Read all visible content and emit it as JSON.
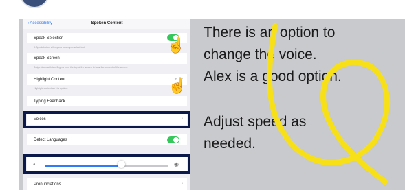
{
  "settings": {
    "back_label": "‹ Accessibility",
    "title": "Spoken Content",
    "speak_selection": {
      "label": "Speak Selection",
      "description": "A Speak button will appear when you select text.",
      "on": true
    },
    "speak_screen": {
      "label": "Speak Screen",
      "description": "Swipe down with two fingers from the top of the screen to hear the content of the screen."
    },
    "highlight_content": {
      "label": "Highlight Content",
      "description": "Highlight content as it is spoken.",
      "value": "On"
    },
    "typing_feedback": {
      "label": "Typing Feedback"
    },
    "voices": {
      "label": "Voices"
    },
    "detect_languages": {
      "label": "Detect Languages",
      "on": true
    },
    "speaking_rate": {
      "level": 0.62
    },
    "pronunciations": {
      "label": "Pronunciations"
    }
  },
  "caption": {
    "line1": "There is an option to",
    "line2": "change the voice.",
    "line3": "Alex is a good option.",
    "line4": "Adjust speed as",
    "line5": "needed."
  },
  "colors": {
    "highlight_box": "#0b1a4a",
    "toggle_on": "#34c759",
    "scribble": "#f7e018",
    "background_panel": "#c9cacd"
  },
  "icons": {
    "pointer_hand": "pointing-hand-icon",
    "slow_rate": "turtle-icon",
    "fast_rate": "hare-icon"
  }
}
